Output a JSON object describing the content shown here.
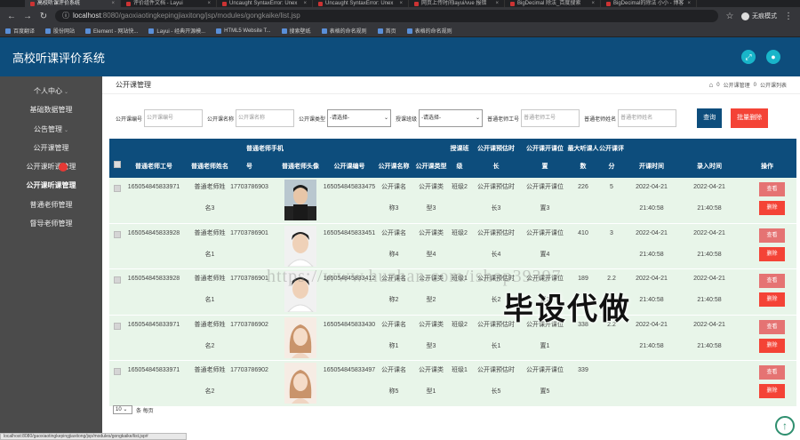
{
  "browser": {
    "tabs": [
      {
        "label": "高校听课评价系统",
        "active": true
      },
      {
        "label": "评价组件文档 - Layui"
      },
      {
        "label": "Uncaught SyntaxError: Unex"
      },
      {
        "label": "Uncaught SyntaxError: Unex"
      },
      {
        "label": "网页上传时间layui/vue 报错"
      },
      {
        "label": "BigDecimal 除法_百度搜索"
      },
      {
        "label": "BigDecimal的除法 小小 - 博客"
      }
    ],
    "url_host": "localhost",
    "url_path": ":8080/gaoxiaotingkepingjiaxitong/jsp/modules/gongkaike/list.jsp",
    "incognito_label": "无痕模式",
    "bookmarks": [
      "百度翻译",
      "股份网站",
      "Element - 网站快...",
      "Layui - 经典开源模...",
      "HTML5 Website T...",
      "搜索壁纸",
      "表格的命名规则",
      "首页",
      "表格的命名规则"
    ]
  },
  "header": {
    "title": "高校听课评价系统"
  },
  "sidebar": {
    "items": [
      {
        "label": "个人中心",
        "chevron": true
      },
      {
        "label": "基础数据管理"
      },
      {
        "label": "公告管理",
        "chevron": true
      },
      {
        "label": "公开课管理"
      },
      {
        "label": "公开课听课管理"
      },
      {
        "label": "公开课听课管理",
        "active": true
      },
      {
        "label": "普通老师管理"
      },
      {
        "label": "督导老师管理"
      }
    ]
  },
  "content": {
    "page_title": "公开课管理",
    "breadcrumb": [
      "公开课管理",
      "公开课列表"
    ],
    "filters": {
      "f1_label": "公开课编号",
      "f1_placeholder": "公开课编号",
      "f2_label": "公开课名称",
      "f2_placeholder": "公开课名称",
      "f3_label": "公开课类型",
      "f3_value": "-请选择-",
      "f4_label": "授课班级",
      "f4_value": "-请选择-",
      "f5_label": "普通老师工号",
      "f5_placeholder": "普通老师工号",
      "f6_label": "普通老师姓名",
      "f6_placeholder": "普通老师姓名",
      "search": "查询",
      "bulk_delete": "批量删除"
    },
    "table": {
      "top_headers": {
        "phone": "普通老师手机",
        "class": "授课班",
        "duration": "公开课预估时",
        "location": "公开课开课位",
        "max": "最大听课人",
        "score": "公开课评"
      },
      "headers": {
        "teacher_no": "普通老师工号",
        "teacher_name": "普通老师姓名",
        "phone": "号",
        "avatar": "普通老师头像",
        "course_no": "公开课编号",
        "course_name": "公开课名称",
        "course_type": "公开课类型",
        "class": "级",
        "duration": "长",
        "location": "置",
        "max": "数",
        "score": "分",
        "start": "开课时间",
        "entry": "录入时间",
        "op": "操作"
      },
      "rows": [
        {
          "teacher_no": "165054845833971",
          "teacher_name_1": "普通老师姓",
          "teacher_name_2": "名3",
          "phone": "17703786903",
          "avatar": "man-dark",
          "course_no": "165054845833475",
          "course_name_1": "公开课名",
          "course_name_2": "称3",
          "course_type_1": "公开课类",
          "course_type_2": "型3",
          "class": "班级2",
          "duration_1": "公开课预估时",
          "duration_2": "长3",
          "location_1": "公开课开课位",
          "location_2": "置3",
          "max": "226",
          "score": "5",
          "start_1": "2022-04-21",
          "start_2": "21:40:58",
          "entry_1": "2022-04-21",
          "entry_2": "21:40:58",
          "view": "查看",
          "delete": "删除"
        },
        {
          "teacher_no": "165054845833928",
          "teacher_name_1": "普通老师姓",
          "teacher_name_2": "名1",
          "phone": "17703786901",
          "avatar": "man-light",
          "course_no": "165054845833451",
          "course_name_1": "公开课名",
          "course_name_2": "称4",
          "course_type_1": "公开课类",
          "course_type_2": "型4",
          "class": "班级2",
          "duration_1": "公开课预估时",
          "duration_2": "长4",
          "location_1": "公开课开课位",
          "location_2": "置4",
          "max": "410",
          "score": "3",
          "start_1": "2022-04-21",
          "start_2": "21:40:58",
          "entry_1": "2022-04-21",
          "entry_2": "21:40:58",
          "view": "查看",
          "delete": "删除"
        },
        {
          "teacher_no": "165054845833928",
          "teacher_name_1": "普通老师姓",
          "teacher_name_2": "名1",
          "phone": "17703786901",
          "avatar": "man-light",
          "course_no": "165054845833412",
          "course_name_1": "公开课名",
          "course_name_2": "称2",
          "course_type_1": "公开课类",
          "course_type_2": "型2",
          "class": "班级1",
          "duration_1": "公开课预估时",
          "duration_2": "长2",
          "location_1": "公开课开课位",
          "location_2": "置2",
          "max": "189",
          "score": "2.2",
          "start_1": "2022-04-21",
          "start_2": "21:40:58",
          "entry_1": "2022-04-21",
          "entry_2": "21:40:58",
          "view": "查看",
          "delete": "删除"
        },
        {
          "teacher_no": "165054845833971",
          "teacher_name_1": "普通老师姓",
          "teacher_name_2": "名2",
          "phone": "17703786902",
          "avatar": "woman",
          "course_no": "165054845833430",
          "course_name_1": "公开课名",
          "course_name_2": "称1",
          "course_type_1": "公开课类",
          "course_type_2": "型3",
          "class": "班级2",
          "duration_1": "公开课预估时",
          "duration_2": "长1",
          "location_1": "公开课开课位",
          "location_2": "置1",
          "max": "338",
          "score": "2.2",
          "start_1": "2022-04-21",
          "start_2": "21:40:58",
          "entry_1": "2022-04-21",
          "entry_2": "21:40:58",
          "view": "查看",
          "delete": "删除"
        },
        {
          "teacher_no": "165054845833971",
          "teacher_name_1": "普通老师姓",
          "teacher_name_2": "名2",
          "phone": "17703786902",
          "avatar": "woman",
          "course_no": "165054845833497",
          "course_name_1": "公开课名",
          "course_name_2": "称5",
          "course_type_1": "公开课类",
          "course_type_2": "型1",
          "class": "班级1",
          "duration_1": "公开课预估时",
          "duration_2": "长5",
          "location_1": "公开课开课位",
          "location_2": "置5",
          "max": "339",
          "score": "",
          "start_1": "",
          "start_2": "",
          "entry_1": "",
          "entry_2": "",
          "view": "查看",
          "delete": "删除"
        }
      ]
    },
    "pager": {
      "page_size": "10",
      "suffix": "条 每页"
    }
  },
  "watermark": {
    "url": "https://www.huzhan.com/ishop39397",
    "text": "毕设代做"
  },
  "status_bar": "localhost:8080/gaoxiaotingkepingjiaxitong/jsp/modules/gongkaike/list.jsp#"
}
